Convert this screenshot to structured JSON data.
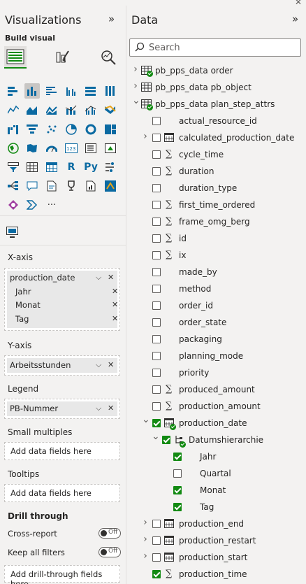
{
  "visualizations": {
    "title": "Visualizations",
    "build_visual_label": "Build visual",
    "x_axis": {
      "label": "X-axis",
      "field": "production_date",
      "subfields": [
        "Jahr",
        "Monat",
        "Tag"
      ]
    },
    "y_axis": {
      "label": "Y-axis",
      "field": "Arbeitsstunden"
    },
    "legend": {
      "label": "Legend",
      "field": "PB-Nummer"
    },
    "small_multiples": {
      "label": "Small multiples",
      "placeholder": "Add data fields here"
    },
    "tooltips": {
      "label": "Tooltips",
      "placeholder": "Add data fields here"
    },
    "drill_through": {
      "label": "Drill through",
      "cross_report": {
        "label": "Cross-report",
        "state": "Off"
      },
      "keep_all_filters": {
        "label": "Keep all filters",
        "state": "Off"
      },
      "placeholder": "Add drill-through fields here"
    },
    "gallery_text_icons": {
      "r": "R",
      "py": "Py",
      "more": "···"
    }
  },
  "data": {
    "title": "Data",
    "search_placeholder": "Search",
    "tables": [
      {
        "name": "pb_pps_data order",
        "expanded": false
      },
      {
        "name": "pb_pps_data pb_object",
        "expanded": false
      },
      {
        "name": "pb_pps_data plan_step_attrs",
        "expanded": true
      }
    ],
    "fields": [
      {
        "name": "actual_resource_id",
        "icon": "none",
        "checked": false,
        "chevron": "none"
      },
      {
        "name": "calculated_production_date",
        "icon": "calendar",
        "checked": false,
        "chevron": "right"
      },
      {
        "name": "cycle_time",
        "icon": "sigma",
        "checked": false,
        "chevron": "none"
      },
      {
        "name": "duration",
        "icon": "sigma",
        "checked": false,
        "chevron": "none"
      },
      {
        "name": "duration_type",
        "icon": "none",
        "checked": false,
        "chevron": "none"
      },
      {
        "name": "first_time_ordered",
        "icon": "sigma",
        "checked": false,
        "chevron": "none"
      },
      {
        "name": "frame_omg_berg",
        "icon": "sigma",
        "checked": false,
        "chevron": "none"
      },
      {
        "name": "id",
        "icon": "sigma",
        "checked": false,
        "chevron": "none"
      },
      {
        "name": "ix",
        "icon": "sigma",
        "checked": false,
        "chevron": "none"
      },
      {
        "name": "made_by",
        "icon": "none",
        "checked": false,
        "chevron": "none"
      },
      {
        "name": "method",
        "icon": "none",
        "checked": false,
        "chevron": "none"
      },
      {
        "name": "order_id",
        "icon": "none",
        "checked": false,
        "chevron": "none"
      },
      {
        "name": "order_state",
        "icon": "none",
        "checked": false,
        "chevron": "none"
      },
      {
        "name": "packaging",
        "icon": "none",
        "checked": false,
        "chevron": "none"
      },
      {
        "name": "planning_mode",
        "icon": "none",
        "checked": false,
        "chevron": "none"
      },
      {
        "name": "priority",
        "icon": "none",
        "checked": false,
        "chevron": "none"
      },
      {
        "name": "produced_amount",
        "icon": "sigma",
        "checked": false,
        "chevron": "none"
      },
      {
        "name": "production_amount",
        "icon": "sigma",
        "checked": false,
        "chevron": "none"
      },
      {
        "name": "production_date",
        "icon": "calendar",
        "checked": true,
        "chevron": "down"
      }
    ],
    "hierarchy": {
      "name": "Datumshierarchie",
      "levels": [
        {
          "name": "Jahr",
          "checked": true
        },
        {
          "name": "Quartal",
          "checked": false
        },
        {
          "name": "Monat",
          "checked": true
        },
        {
          "name": "Tag",
          "checked": true
        }
      ]
    },
    "fields_after": [
      {
        "name": "production_end",
        "icon": "calendar",
        "checked": false,
        "chevron": "right"
      },
      {
        "name": "production_restart",
        "icon": "calendar",
        "checked": false,
        "chevron": "right"
      },
      {
        "name": "production_start",
        "icon": "calendar",
        "checked": false,
        "chevron": "right"
      },
      {
        "name": "production_time",
        "icon": "sigma",
        "checked": true,
        "chevron": "none"
      }
    ]
  },
  "colors": {
    "accent": "#128a12",
    "icon_blue": "#0b6aa2",
    "pane_bg": "#f3f2f1"
  }
}
